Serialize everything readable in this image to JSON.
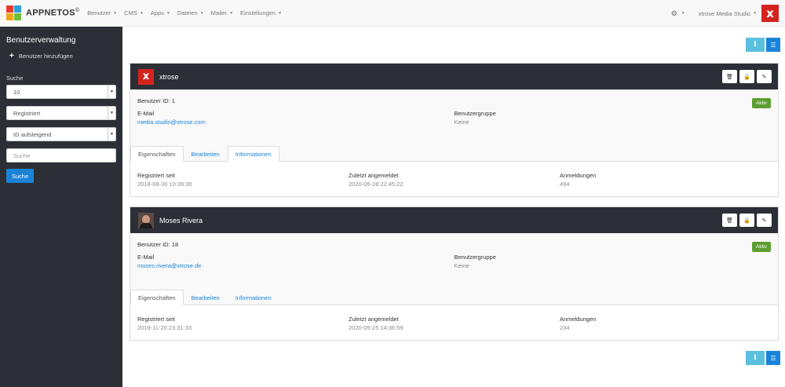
{
  "app": {
    "brand": "APPNETOS",
    "brand_mark": "®",
    "logo_colors": [
      "#e8392a",
      "#2a9fd8",
      "#f3a51b",
      "#6cbf3d"
    ]
  },
  "nav": {
    "items": [
      {
        "label": "Benutzer",
        "key": "benutzer"
      },
      {
        "label": "CMS",
        "key": "cms"
      },
      {
        "label": "Apps",
        "key": "apps"
      },
      {
        "label": "Dateien",
        "key": "dateien"
      },
      {
        "label": "Mailer",
        "key": "mailer"
      },
      {
        "label": "Einstellungen",
        "key": "einstellungen"
      }
    ],
    "studio": "xtrose Media Studio",
    "avatar_letter": "x"
  },
  "sidebar": {
    "title": "Benutzerverwaltung",
    "add_label": "Benutzer hinzufügen",
    "search_label": "Suche",
    "per_page": "10",
    "sort_field": "Registriert",
    "sort_order": "ID aufsteigend",
    "search_placeholder": "Suche",
    "search_button": "Suche"
  },
  "users": [
    {
      "name": "xtrose",
      "avatar": "x",
      "id_label": "Benutzer ID: 1",
      "status": "Aktiv",
      "email_label": "E-Mail",
      "email": "media.studio@xtrose.com",
      "group_label": "Benutzergruppe",
      "group": "Keine",
      "tabs": [
        "Eigenschaften",
        "Bearbeiten",
        "Informationen"
      ],
      "registered_label": "Registriert seit",
      "registered": "2018-08-30 10:39:30",
      "last_login_label": "Zuletzt angemeldet",
      "last_login": "2020-05-28 22:45:22",
      "logins_label": "Anmeldungen",
      "logins": "494"
    },
    {
      "name": "Moses Rivera",
      "avatar": "photo",
      "id_label": "Benutzer ID: 18",
      "status": "Aktiv",
      "email_label": "E-Mail",
      "email": "moses.rivera@xtrose.de",
      "group_label": "Benutzergruppe",
      "group": "Keine",
      "tabs": [
        "Eigenschaften",
        "Bearbeiten",
        "Informationen"
      ],
      "registered_label": "Registriert seit",
      "registered": "2019-11-20 23:31:33",
      "last_login_label": "Zuletzt angemeldet",
      "last_login": "2020-05-25 14:36:59",
      "logins_label": "Anmeldungen",
      "logins": "234"
    }
  ],
  "view": {
    "info_glyph": "i",
    "list_glyph": "☰"
  },
  "colors": {
    "primary": "#1a83d8",
    "info": "#5bc0de",
    "success": "#5d9e32",
    "dark": "#2c3036",
    "brand_red": "#d4231e"
  }
}
